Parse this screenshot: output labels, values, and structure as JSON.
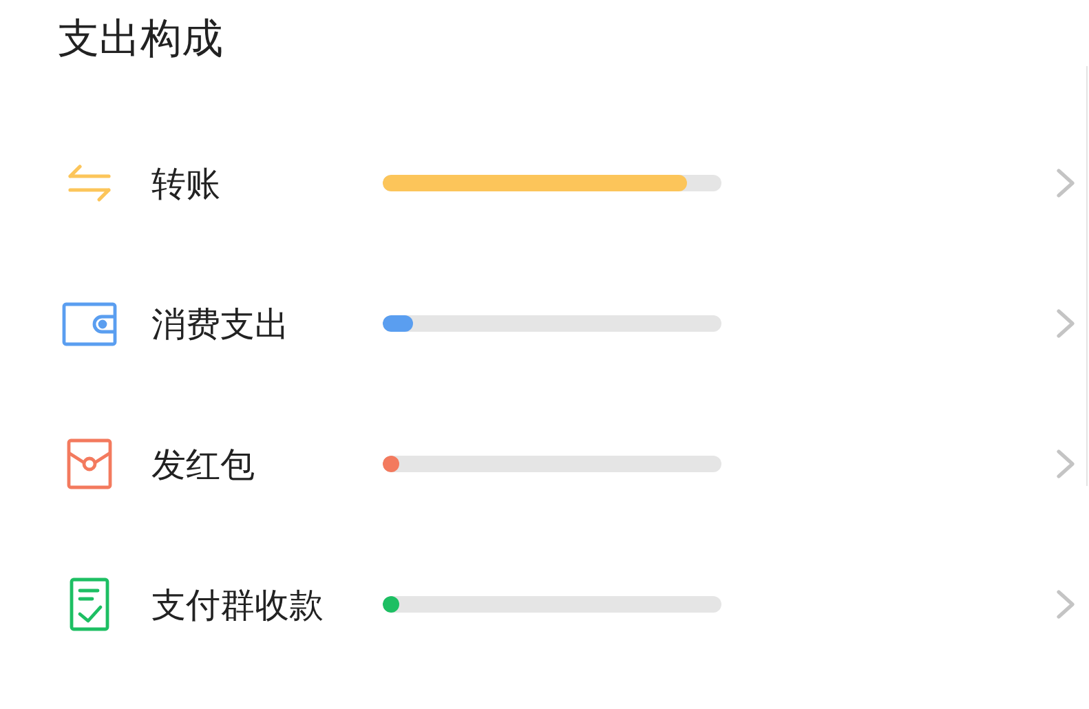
{
  "title": "支出构成",
  "items": [
    {
      "kind": "transfer",
      "label": "转账",
      "level": 0.9,
      "color": "#fcc55a"
    },
    {
      "kind": "wallet",
      "label": "消费支出",
      "level": 0.09,
      "color": "#5a9ef0"
    },
    {
      "kind": "envelope",
      "label": "发红包",
      "level": 0.05,
      "color": "#f37a5e"
    },
    {
      "kind": "receipt",
      "label": "支付群收款",
      "level": 0.05,
      "color": "#1dbf63"
    }
  ]
}
